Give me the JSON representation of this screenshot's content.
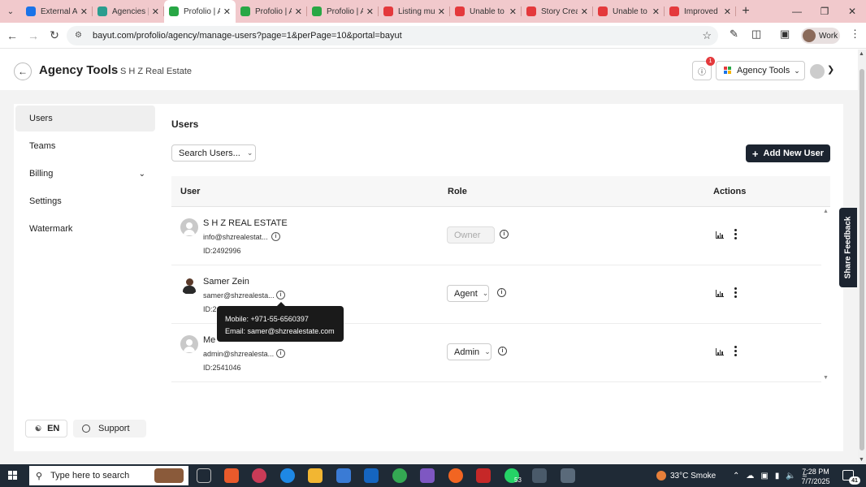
{
  "browser": {
    "tabs": [
      {
        "title": "External Ag",
        "color": "#1a73e8",
        "active": false
      },
      {
        "title": "Agencies |",
        "color": "#2a9d8f",
        "active": false
      },
      {
        "title": "Profolio | A",
        "color": "#28a745",
        "active": true
      },
      {
        "title": "Profolio | A",
        "color": "#28a745",
        "active": false
      },
      {
        "title": "Profolio | A",
        "color": "#28a745",
        "active": false
      },
      {
        "title": "Listing mu",
        "color": "#e4393c",
        "active": false
      },
      {
        "title": "Unable to",
        "color": "#e4393c",
        "active": false
      },
      {
        "title": "Story Crea",
        "color": "#e4393c",
        "active": false
      },
      {
        "title": "Unable to",
        "color": "#e4393c",
        "active": false
      },
      {
        "title": "Improved",
        "color": "#e4393c",
        "active": false
      }
    ],
    "url": "bayut.com/profolio/agency/manage-users?page=1&perPage=10&portal=bayut",
    "profile_label": "Work"
  },
  "header": {
    "title": "Agency Tools",
    "agency_name": "S H Z Real Estate",
    "notification_count": "1",
    "tools_dropdown_label": "Agency Tools"
  },
  "sidebar": {
    "items": [
      {
        "label": "Users",
        "active": true
      },
      {
        "label": "Teams",
        "active": false
      },
      {
        "label": "Billing",
        "active": false,
        "expandable": true
      },
      {
        "label": "Settings",
        "active": false
      },
      {
        "label": "Watermark",
        "active": false
      }
    ],
    "language_label": "EN",
    "support_label": "Support"
  },
  "main": {
    "title": "Users",
    "search_label": "Search Users...",
    "add_button_label": "Add New User",
    "columns": {
      "user": "User",
      "role": "Role",
      "actions": "Actions"
    },
    "users": [
      {
        "name": "S H Z REAL ESTATE",
        "email": "info@shzrealestat...",
        "id": "ID:2492996",
        "role": "Owner",
        "role_disabled": true
      },
      {
        "name": "Samer Zein",
        "email": "samer@shzrealesta...",
        "id": "ID:2",
        "role": "Agent",
        "role_disabled": false
      },
      {
        "name": "Me",
        "email": "admin@shzrealesta...",
        "id": "ID:2541046",
        "role": "Admin",
        "role_disabled": false
      }
    ],
    "tooltip": {
      "mobile": "Mobile: +971-55-6560397",
      "email": "Email: samer@shzrealestate.com"
    }
  },
  "feedback_label": "Share Feedback",
  "taskbar": {
    "search_placeholder": "Type here to search",
    "whatsapp_badge": "53",
    "weather": "33°C  Smoke",
    "time": "7:28 PM",
    "date": "7/7/2025",
    "notification_count": "41"
  }
}
